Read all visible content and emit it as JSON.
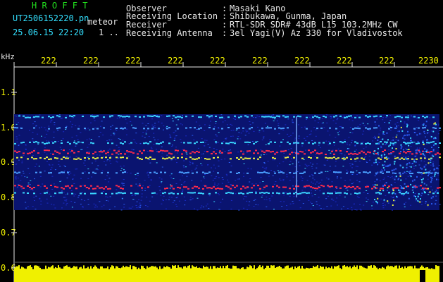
{
  "header": {
    "app_name": "H R O F F T",
    "filename": "UT2506152220.pn",
    "mode": "meteor",
    "datetime": "25.06.15 22:20",
    "page_indicator": "1 ..",
    "info_rows": [
      {
        "label": "Observer",
        "sep": ":",
        "value": "Masaki Kano"
      },
      {
        "label": "Receiving Location",
        "sep": ":",
        "value": "Shibukawa, Gunma, Japan"
      },
      {
        "label": "Receiver",
        "sep": ":",
        "value": "RTL-SDR SDR# 43dB L15 103.2MHz CW"
      },
      {
        "label": "Receiving Antenna",
        "sep": ":",
        "value": "3el Yagi(V) Az 330 for Vladivostok"
      }
    ]
  },
  "axes": {
    "unit_label": "kHz",
    "time_ticks": [
      "222",
      "222",
      "222",
      "222",
      "222",
      "222",
      "222",
      "222",
      "222",
      "2230"
    ],
    "freq_ticks": [
      "1.1",
      "1.0",
      "0.9",
      "0.8",
      "0.7",
      "0.6"
    ]
  },
  "colors": {
    "background": "#000000",
    "text_green": "#22e01e",
    "text_cyan": "#33e0ff",
    "axis_white": "#e8e8e8",
    "signal_yellow": "#f0f000",
    "waterfall_noise": "#1a2cc8",
    "waterfall_mid": "#3ad6ff",
    "waterfall_hot": "#ff2a4a"
  }
}
